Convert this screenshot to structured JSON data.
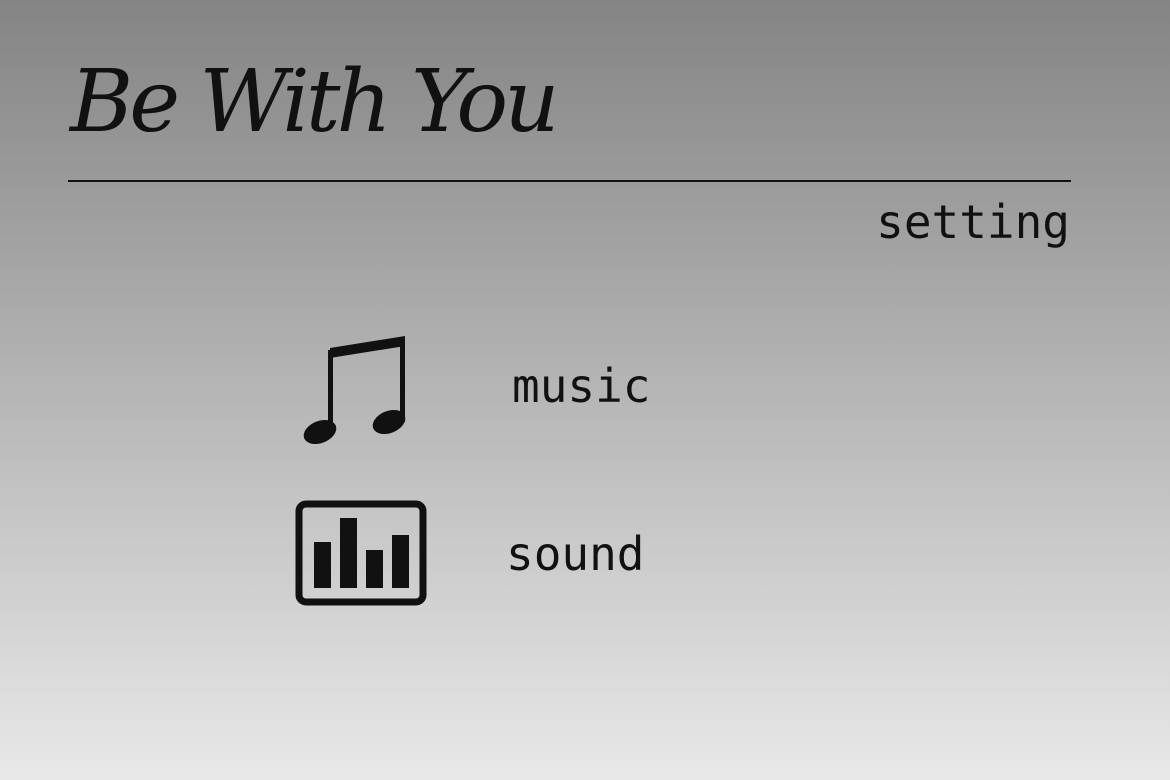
{
  "app": {
    "title": "Be With You"
  },
  "page": {
    "subtitle": "setting"
  },
  "settings": {
    "items": [
      {
        "label": "music",
        "icon": "music-note-icon"
      },
      {
        "label": "sound",
        "icon": "equalizer-icon"
      }
    ]
  },
  "colors": {
    "text": "#111111",
    "background_top": "#848484",
    "background_bottom": "#e8e8e8"
  }
}
